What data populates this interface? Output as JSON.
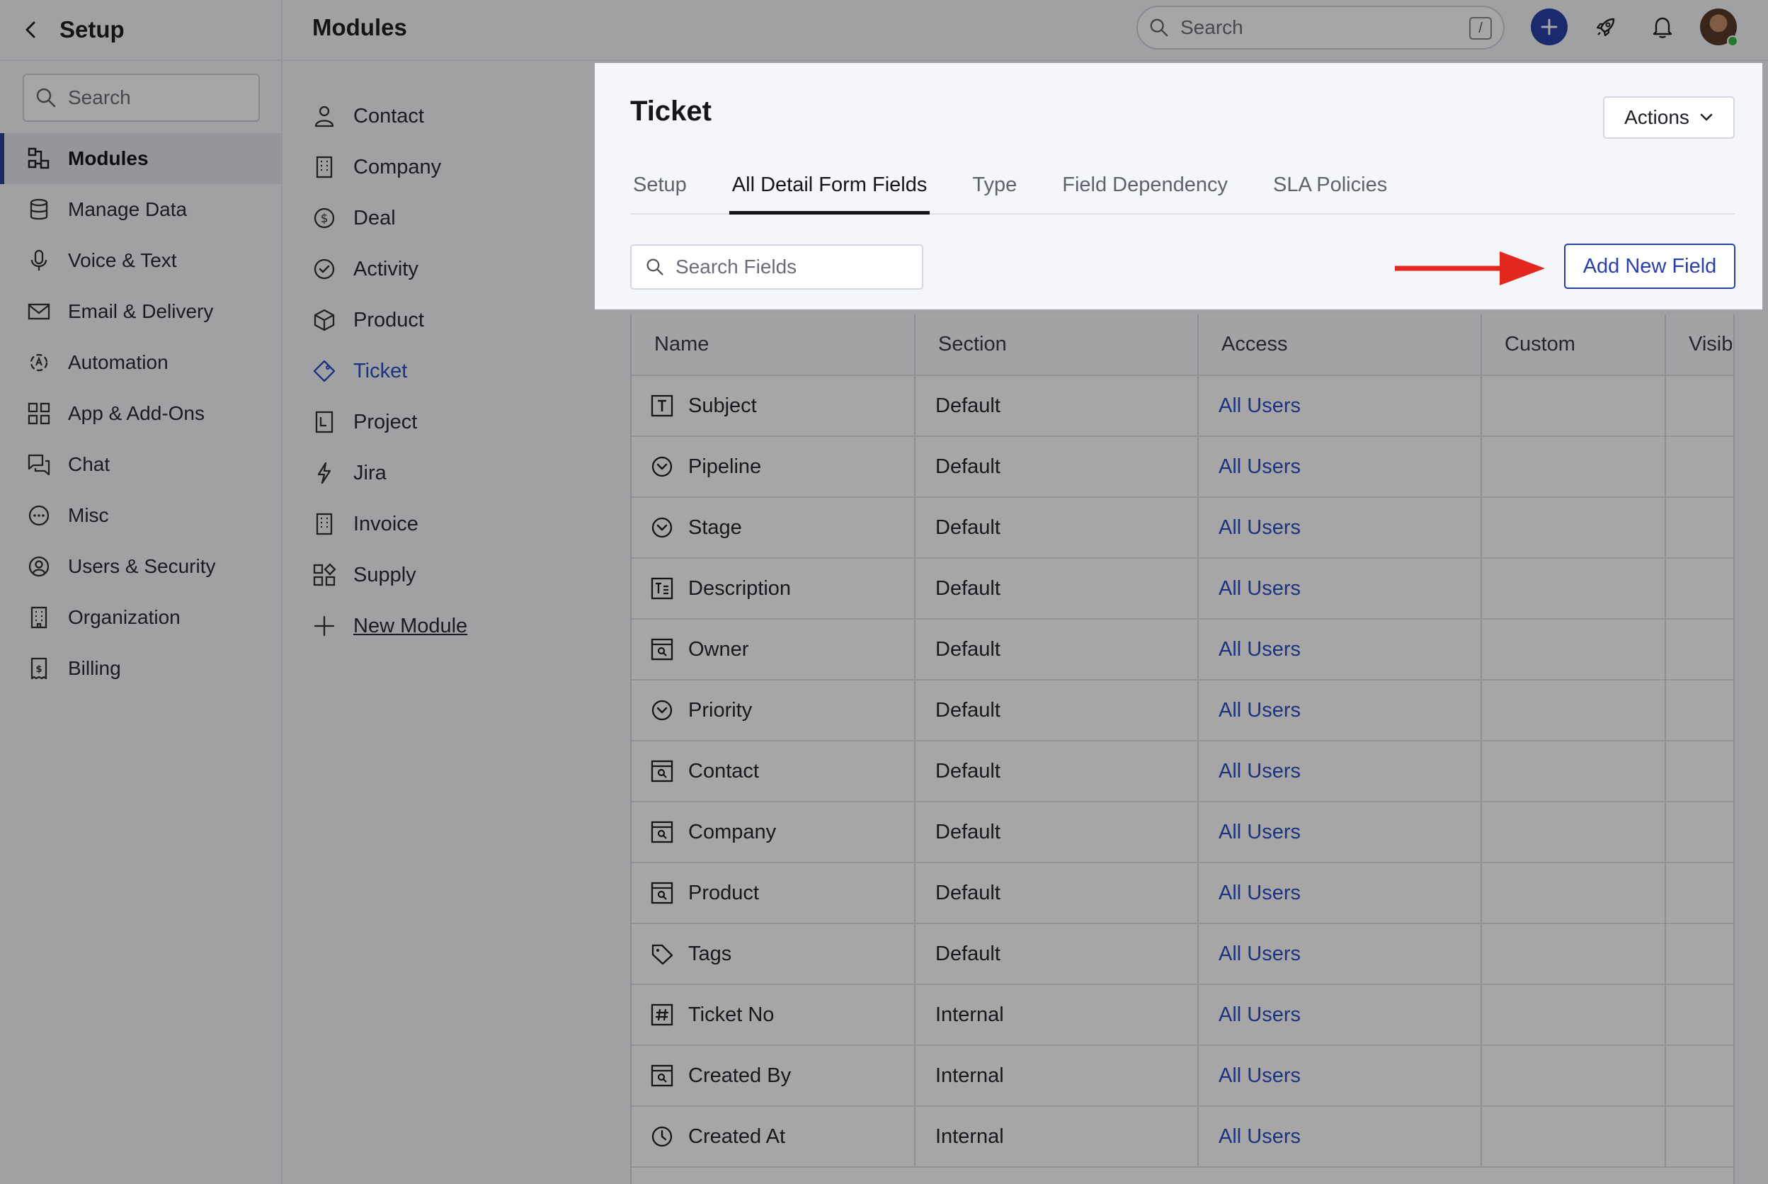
{
  "sidebar": {
    "title": "Setup",
    "search_placeholder": "Search",
    "items": [
      {
        "label": "Modules",
        "icon": "modules-icon",
        "active": true
      },
      {
        "label": "Manage Data",
        "icon": "database-icon"
      },
      {
        "label": "Voice & Text",
        "icon": "microphone-icon"
      },
      {
        "label": "Email & Delivery",
        "icon": "mail-icon"
      },
      {
        "label": "Automation",
        "icon": "automation-icon"
      },
      {
        "label": "App & Add-Ons",
        "icon": "apps-grid-icon"
      },
      {
        "label": "Chat",
        "icon": "chat-icon"
      },
      {
        "label": "Misc",
        "icon": "more-circle-icon"
      },
      {
        "label": "Users & Security",
        "icon": "user-circle-icon"
      },
      {
        "label": "Organization",
        "icon": "building-icon"
      },
      {
        "label": "Billing",
        "icon": "receipt-icon"
      }
    ]
  },
  "header": {
    "title": "Modules",
    "search_placeholder": "Search",
    "search_shortcut": "/",
    "accent_color": "#2a3fa8"
  },
  "modules": {
    "items": [
      {
        "label": "Contact",
        "icon": "person-icon"
      },
      {
        "label": "Company",
        "icon": "building-icon"
      },
      {
        "label": "Deal",
        "icon": "dollar-circle-icon"
      },
      {
        "label": "Activity",
        "icon": "check-circle-icon"
      },
      {
        "label": "Product",
        "icon": "box-icon"
      },
      {
        "label": "Ticket",
        "icon": "ticket-tag-icon",
        "active": true
      },
      {
        "label": "Project",
        "icon": "project-icon"
      },
      {
        "label": "Jira",
        "icon": "lightning-icon"
      },
      {
        "label": "Invoice",
        "icon": "invoice-icon"
      },
      {
        "label": "Supply",
        "icon": "supply-grid-icon"
      }
    ],
    "new_module_label": "New Module"
  },
  "panel": {
    "title": "Ticket",
    "actions_label": "Actions",
    "tabs": [
      "Setup",
      "All Detail Form Fields",
      "Type",
      "Field Dependency",
      "SLA Policies"
    ],
    "active_tab": "All Detail Form Fields",
    "search_placeholder": "Search Fields",
    "add_button_label": "Add New Field"
  },
  "table": {
    "columns": [
      "Name",
      "Section",
      "Access",
      "Custom",
      "Visib"
    ],
    "rows": [
      {
        "name": "Subject",
        "icon": "text-field-icon",
        "section": "Default",
        "access": "All Users"
      },
      {
        "name": "Pipeline",
        "icon": "dropdown-circle-icon",
        "section": "Default",
        "access": "All Users"
      },
      {
        "name": "Stage",
        "icon": "dropdown-circle-icon",
        "section": "Default",
        "access": "All Users"
      },
      {
        "name": "Description",
        "icon": "textarea-icon",
        "section": "Default",
        "access": "All Users"
      },
      {
        "name": "Owner",
        "icon": "lookup-icon",
        "section": "Default",
        "access": "All Users"
      },
      {
        "name": "Priority",
        "icon": "dropdown-circle-icon",
        "section": "Default",
        "access": "All Users"
      },
      {
        "name": "Contact",
        "icon": "lookup-icon",
        "section": "Default",
        "access": "All Users"
      },
      {
        "name": "Company",
        "icon": "lookup-icon",
        "section": "Default",
        "access": "All Users"
      },
      {
        "name": "Product",
        "icon": "lookup-icon",
        "section": "Default",
        "access": "All Users"
      },
      {
        "name": "Tags",
        "icon": "tag-icon",
        "section": "Default",
        "access": "All Users"
      },
      {
        "name": "Ticket No",
        "icon": "hash-icon",
        "section": "Internal",
        "access": "All Users"
      },
      {
        "name": "Created By",
        "icon": "lookup-icon",
        "section": "Internal",
        "access": "All Users"
      },
      {
        "name": "Created At",
        "icon": "clock-icon",
        "section": "Internal",
        "access": "All Users"
      }
    ]
  }
}
